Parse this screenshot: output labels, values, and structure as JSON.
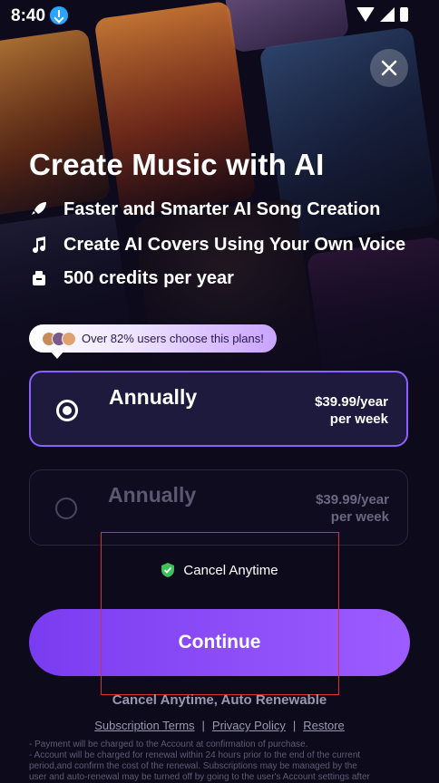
{
  "status_bar": {
    "time": "8:40"
  },
  "title": "Create Music with AI",
  "features": [
    {
      "icon": "rocket-icon",
      "label": "Faster and Smarter AI Song Creation"
    },
    {
      "icon": "music-note-icon",
      "label": "Create AI Covers Using Your Own Voice"
    },
    {
      "icon": "credits-icon",
      "label": "500 credits per year"
    }
  ],
  "badge": {
    "text": "Over 82% users choose this plans!"
  },
  "plans": [
    {
      "name": "Annually",
      "price": "$39.99/year",
      "sub": "per week",
      "selected": true
    },
    {
      "name": "Annually",
      "price": "$39.99/year",
      "sub": "per week",
      "selected": false
    }
  ],
  "cancel_anytime": "Cancel Anytime",
  "continue_label": "Continue",
  "auto_renew": "Cancel Anytime, Auto Renewable",
  "links": {
    "terms": "Subscription Terms",
    "privacy": "Privacy Policy",
    "restore": "Restore",
    "separator": "|"
  },
  "fine_print": [
    "- Payment will be charged to the Account at confirmation of purchase.",
    "- Account will be charged for renewal within 24 hours prior to the end of the current",
    "period,and confirm the cost of the renewal. Subscriptions may be managed by the",
    "user and auto-renewal may be turned off by going to the user's Account settings after"
  ],
  "colors": {
    "accent": "#8b62f5",
    "button": "#7a3cf0",
    "background": "#0d0a1c",
    "shield": "#3fbf5a"
  }
}
